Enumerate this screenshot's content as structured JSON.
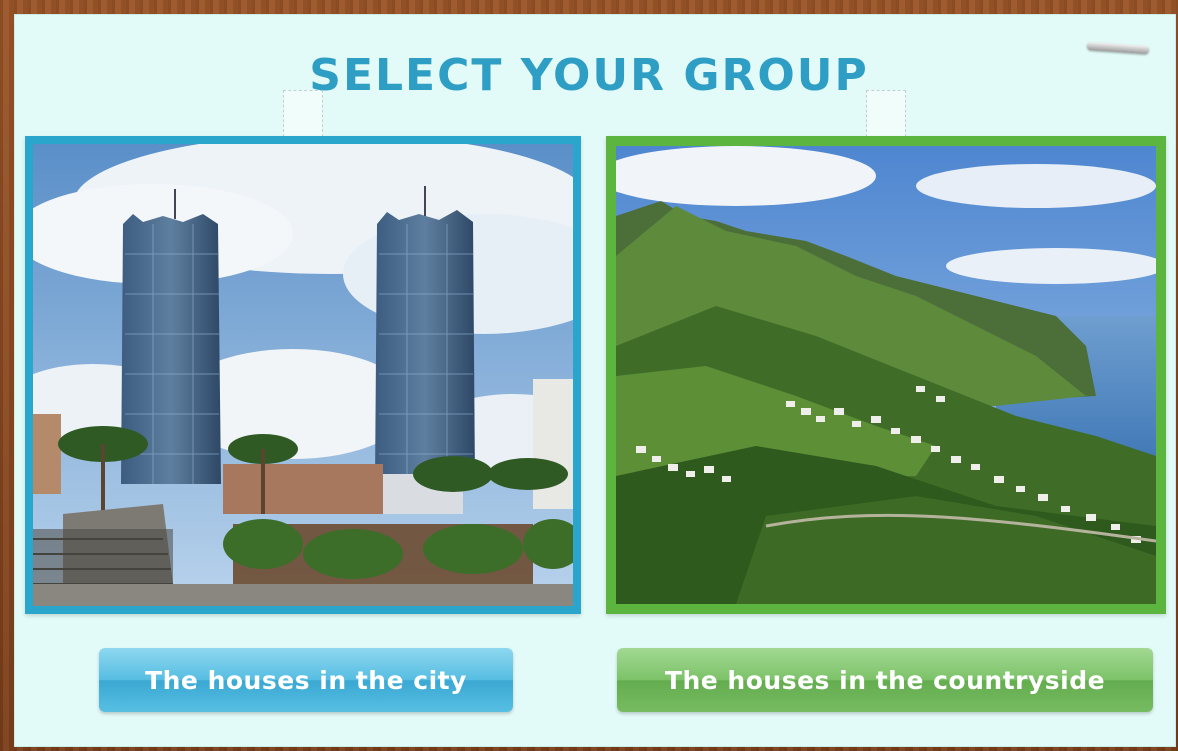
{
  "title": "SELECT YOUR GROUP",
  "options": [
    {
      "id": "city",
      "button_label": "The houses in the city",
      "frame_color": "#2aa6cc",
      "button_color": "#56bde2",
      "image": "city-towers-photo"
    },
    {
      "id": "countryside",
      "button_label": "The houses in the countryside",
      "frame_color": "#5bb53e",
      "button_color": "#7cc268",
      "image": "mountain-village-photo"
    }
  ],
  "icons": {
    "close": "close-bar-icon"
  },
  "colors": {
    "title": "#2e9ec4",
    "board_background": "#e3fbf8",
    "wood_frame": "#8a4a22"
  }
}
